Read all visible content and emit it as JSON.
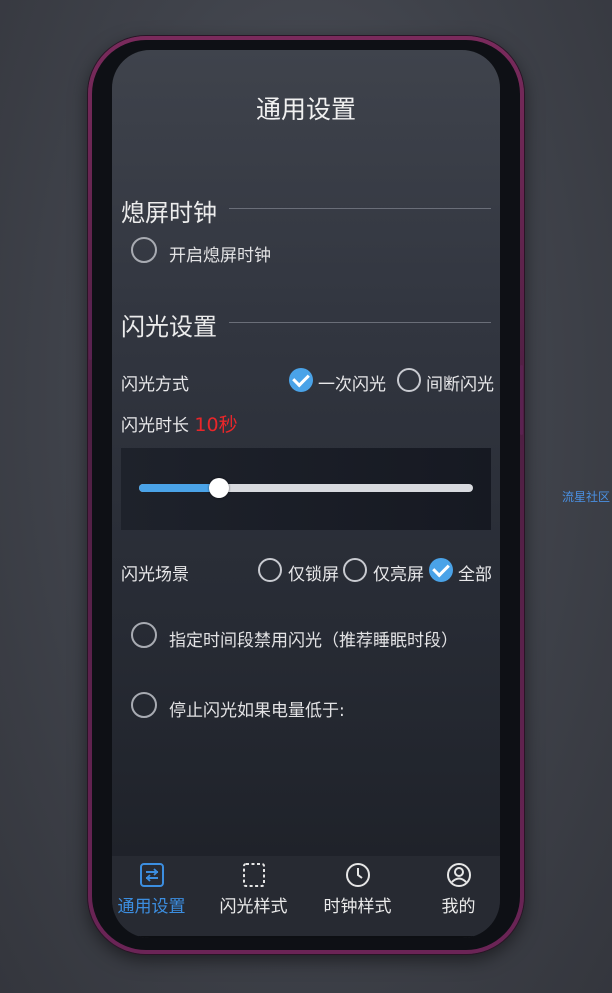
{
  "watermark": "流星社区",
  "page_title": "通用设置",
  "aod_section": {
    "title": "熄屏时钟",
    "enable_label": "开启熄屏时钟",
    "enabled": false
  },
  "flash_section": {
    "title": "闪光设置",
    "mode_label": "闪光方式",
    "mode_options": [
      {
        "label": "一次闪光",
        "checked": true
      },
      {
        "label": "间断闪光",
        "checked": false
      }
    ],
    "duration_label": "闪光时长",
    "duration_value": "10秒",
    "duration_slider_fraction": 0.24,
    "scene_label": "闪光场景",
    "scene_options": [
      {
        "label": "仅锁屏",
        "checked": false
      },
      {
        "label": "仅亮屏",
        "checked": false
      },
      {
        "label": "全部",
        "checked": true
      }
    ],
    "disable_period_label": "指定时间段禁用闪光（推荐睡眠时段）",
    "disable_period_enabled": false,
    "battery_stop_label": "停止闪光如果电量低于:",
    "battery_stop_enabled": false
  },
  "nav": {
    "items": [
      {
        "label": "通用设置",
        "icon": "settings-sliders-icon",
        "active": true
      },
      {
        "label": "闪光样式",
        "icon": "dashed-frame-icon",
        "active": false
      },
      {
        "label": "时钟样式",
        "icon": "clock-icon",
        "active": false
      },
      {
        "label": "我的",
        "icon": "user-icon",
        "active": false
      }
    ]
  },
  "colors": {
    "accent": "#4aa3e8",
    "active_nav": "#3c8ee0",
    "duration_value": "#e8262a",
    "phone_frame": "#6b2456"
  }
}
